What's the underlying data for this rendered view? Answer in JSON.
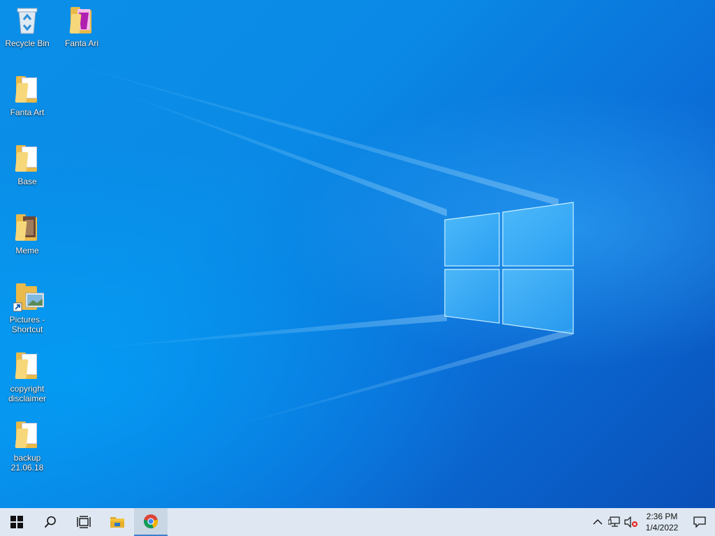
{
  "desktop": {
    "icons": [
      {
        "label": "Recycle Bin",
        "icon": "recycle-bin-icon"
      },
      {
        "label": "Fanta Ari",
        "icon": "folder-icon"
      },
      {
        "label": "Fanta Art",
        "icon": "folder-icon"
      },
      {
        "label": "Base",
        "icon": "folder-icon"
      },
      {
        "label": "Meme",
        "icon": "folder-icon"
      },
      {
        "label": "Pictures - Shortcut",
        "icon": "folder-shortcut-icon"
      },
      {
        "label": "copyright disclaimer",
        "icon": "folder-icon"
      },
      {
        "label": "backup 21.06.18",
        "icon": "folder-icon"
      }
    ]
  },
  "taskbar": {
    "buttons": [
      {
        "name": "start",
        "icon": "windows-logo-icon"
      },
      {
        "name": "search",
        "icon": "search-icon"
      },
      {
        "name": "task-view",
        "icon": "task-view-icon"
      },
      {
        "name": "file-explorer",
        "icon": "file-explorer-icon"
      },
      {
        "name": "chrome",
        "icon": "chrome-icon"
      }
    ],
    "tray": {
      "time": "2:36 PM",
      "date": "1/4/2022"
    }
  },
  "colors": {
    "accent": "#0a78e0",
    "taskbar": "#dfe8f2",
    "folder": "#e9b949"
  }
}
